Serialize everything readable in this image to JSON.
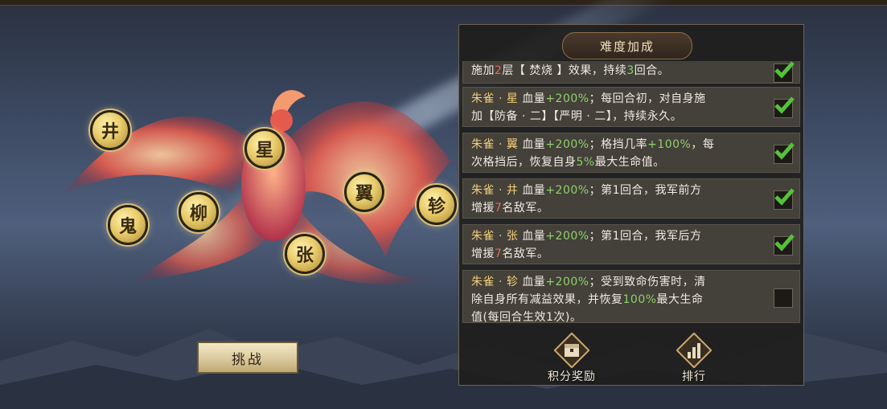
{
  "panel": {
    "title": "难度加成"
  },
  "challenge_button": {
    "label": "挑战"
  },
  "stars": [
    {
      "id": "jing",
      "label": "井"
    },
    {
      "id": "xing",
      "label": "星"
    },
    {
      "id": "yi",
      "label": "翼"
    },
    {
      "id": "zhen",
      "label": "轸"
    },
    {
      "id": "gui",
      "label": "鬼"
    },
    {
      "id": "liu",
      "label": "柳"
    },
    {
      "id": "zhang",
      "label": "张"
    }
  ],
  "entries": [
    {
      "parts": [
        "施加",
        "2",
        "层【 焚烧 】效果，持续",
        "3",
        "回合。"
      ],
      "checked": true
    },
    {
      "name": "朱雀 · 星",
      "hp": "血量",
      "bonus": "+200%",
      "desc_a": "；每回合初，对自身施",
      "desc_b": "加【防备 · 二】【严明 · 二】，持续永久。",
      "checked": true
    },
    {
      "name": "朱雀 · 翼",
      "hp": "血量",
      "bonus": "+200%",
      "desc_a": "；格挡几率",
      "bonus2": "+100%",
      "desc_b": "，每",
      "desc_c": "次格挡后，恢复自身",
      "pct": "5%",
      "desc_d": "最大生命值。",
      "checked": true
    },
    {
      "name": "朱雀 · 井",
      "hp": "血量",
      "bonus": "+200%",
      "desc_a": "；第1回合，我军前方",
      "desc_b": "增援",
      "count": "7",
      "desc_c": "名敌军。",
      "checked": true
    },
    {
      "name": "朱雀 · 张",
      "hp": "血量",
      "bonus": "+200%",
      "desc_a": "；第1回合，我军后方",
      "desc_b": "增援",
      "count": "7",
      "desc_c": "名敌军。",
      "checked": true
    },
    {
      "name": "朱雀 · 轸",
      "hp": "血量",
      "bonus": "+200%",
      "desc_a": "；受到致命伤害时，清",
      "desc_b": "除自身所有减益效果，并恢复",
      "pct": "100%",
      "desc_c": "最大生命",
      "desc_d": "值(每回合生效1次)。",
      "checked": false
    }
  ],
  "footer": {
    "rewards_label": "积分奖励",
    "rank_label": "排行"
  },
  "colors": {
    "highlight_green": "#8ed16b",
    "name_gold": "#f2cf7a",
    "count_red": "#e46b5a"
  },
  "icons": [
    "treasure-chest-icon",
    "ranking-bars-icon",
    "checkmark-icon"
  ]
}
